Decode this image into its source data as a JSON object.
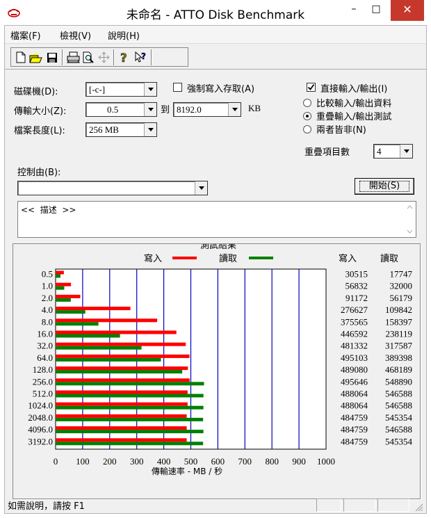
{
  "window": {
    "title": "未命名 - ATTO Disk Benchmark",
    "minimize": "–",
    "maximize": "□",
    "close": "✕"
  },
  "menu": [
    "檔案(F)",
    "檢視(V)",
    "說明(H)"
  ],
  "toolbar": [
    "new-icon",
    "open-icon",
    "save-icon",
    "print-icon",
    "print-preview-icon",
    "move-icon",
    "help-icon",
    "context-help-icon"
  ],
  "form": {
    "drive_label": "磁碟機(D):",
    "drive_value": "[-c-]",
    "force_write_label": "強制寫入存取(A)",
    "force_write_checked": false,
    "direct_io_label": "直接輸入/輸出(I)",
    "direct_io_checked": true,
    "transfer_size_label": "傳輸大小(Z):",
    "transfer_from": "0.5",
    "to_label": "到",
    "transfer_to": "8192.0",
    "kb_label": "KB",
    "file_length_label": "檔案長度(L):",
    "file_length_value": "256 MB",
    "radio_options": [
      "比較輸入/輸出資料",
      "重疊輸入/輸出測試",
      "兩者皆非(N)"
    ],
    "radio_selected": 1,
    "queue_label": "重疊項目數",
    "queue_value": "4",
    "controlled_by_label": "控制由(B):",
    "controlled_by_value": "",
    "start_button": "開始(S)",
    "description_text": "<<  描述  >>"
  },
  "chart_data": {
    "type": "bar",
    "title": "測試結果",
    "legend": [
      {
        "name": "寫入",
        "color": "#ff0000"
      },
      {
        "name": "讀取",
        "color": "#008000"
      }
    ],
    "categories": [
      "0.5",
      "1.0",
      "2.0",
      "4.0",
      "8.0",
      "16.0",
      "32.0",
      "64.0",
      "128.0",
      "256.0",
      "512.0",
      "1024.0",
      "2048.0",
      "4096.0",
      "3192.0"
    ],
    "series": [
      {
        "name": "寫入",
        "color": "#ff0000",
        "values": [
          30515,
          56832,
          91172,
          276627,
          375565,
          446592,
          481332,
          495103,
          489080,
          495646,
          488064,
          488064,
          484759,
          484759,
          484759
        ]
      },
      {
        "name": "讀取",
        "color": "#008000",
        "values": [
          17747,
          32000,
          56179,
          109842,
          158397,
          238119,
          317587,
          389398,
          468189,
          548890,
          546588,
          546588,
          545354,
          546588,
          545354
        ]
      }
    ],
    "write_col_header": "寫入",
    "read_col_header": "讀取",
    "x_ticks": [
      "0",
      "100",
      "200",
      "300",
      "400",
      "500",
      "600",
      "700",
      "800",
      "900",
      "1000"
    ],
    "xlim": [
      0,
      1000
    ],
    "xlabel": "傳輸速率 - MB / 秒",
    "value_divisor": 1000
  },
  "status": {
    "text": "如需說明，請按 F1"
  }
}
